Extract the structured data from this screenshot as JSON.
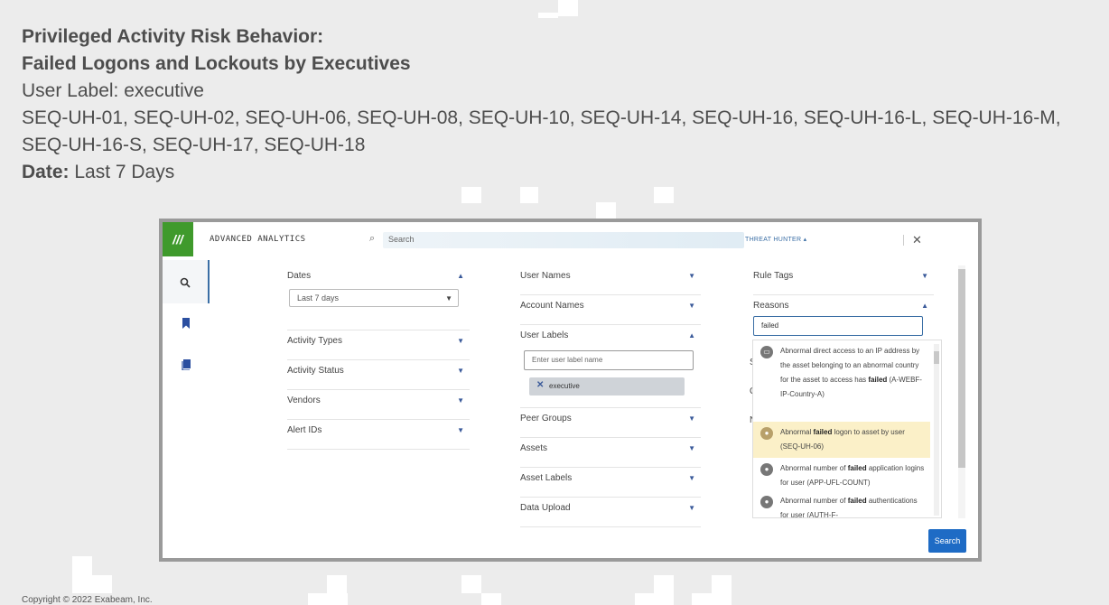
{
  "heading": {
    "title_line1": "Privileged Activity Risk Behavior:",
    "title_line2": "Failed Logons and Lockouts by Executives",
    "user_label_line": "User Label: executive",
    "rules_line1": "SEQ-UH-01, SEQ-UH-02, SEQ-UH-06, SEQ-UH-08, SEQ-UH-10, SEQ-UH-14, SEQ-UH-16, SEQ-UH-16-L, SEQ-UH-16-M,",
    "rules_line2": "SEQ-UH-16-S, SEQ-UH-17, SEQ-UH-18",
    "date_label": "Date:",
    "date_value": " Last 7 Days"
  },
  "copyright": "Copyright © 2022 Exabeam, Inc.",
  "app": {
    "logo": "///",
    "title": "ADVANCED ANALYTICS",
    "search_placeholder": "Search",
    "user_menu": "THREAT HUNTER ▴",
    "close": "✕",
    "search_button": "Search"
  },
  "filters": {
    "col1": {
      "dates_label": "Dates",
      "dates_value": "Last 7 days",
      "rows": [
        "Activity Types",
        "Activity Status",
        "Vendors",
        "Alert IDs"
      ]
    },
    "col2": {
      "top_rows": [
        "User Names",
        "Account Names"
      ],
      "user_labels_label": "User Labels",
      "user_labels_placeholder": "Enter user label name",
      "chip": "executive",
      "bottom_rows": [
        "Peer Groups",
        "Assets",
        "Asset Labels",
        "Data Upload"
      ]
    },
    "col3": {
      "rule_tags": "Rule Tags",
      "reasons": "Reasons",
      "reasons_query": "failed",
      "hidden_letters": [
        "S",
        "C",
        "N"
      ]
    }
  },
  "reasons_dropdown": [
    {
      "pre": "Abnormal direct access to an IP address by the asset belonging to an abnormal country for the asset to access has ",
      "match": "failed",
      "post": " (A-WEBF-IP-Country-A)"
    },
    {
      "pre": "Abnormal ",
      "match": "failed",
      "post": " logon to asset by user (SEQ-UH-06)"
    },
    {
      "pre": "Abnormal number of ",
      "match": "failed",
      "post": " application logins for user (APP-UFL-COUNT)"
    },
    {
      "pre": "Abnormal number of ",
      "match": "failed",
      "post": " authentications for user (AUTH-F-"
    }
  ],
  "colors": {
    "logo_green": "#3f9a2c",
    "accent_blue": "#1e6bc5",
    "highlight": "#fbf0c8"
  }
}
